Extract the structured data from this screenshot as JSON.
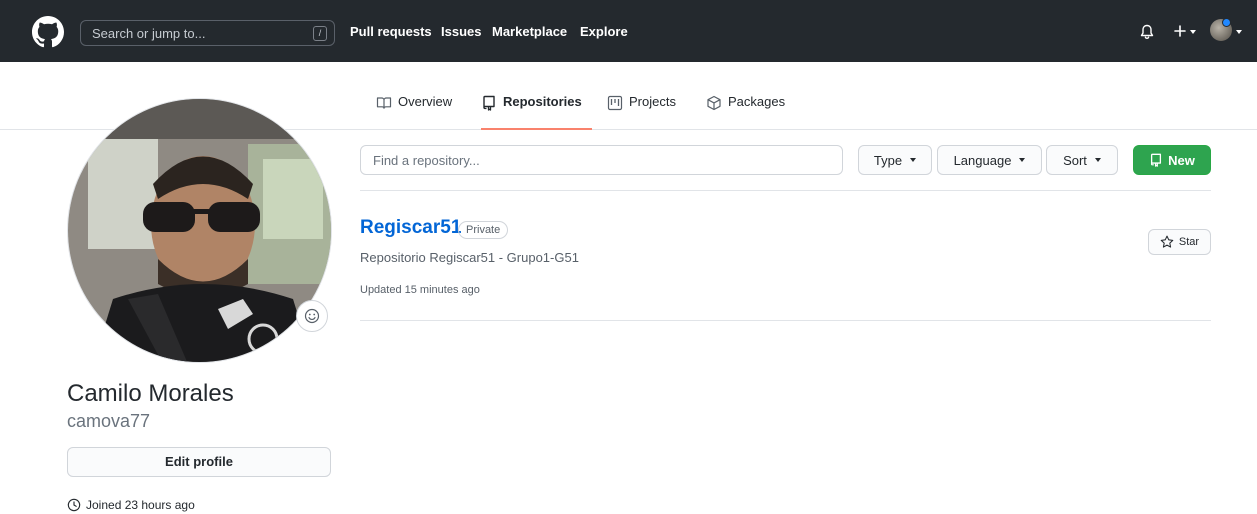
{
  "header": {
    "search_placeholder": "Search or jump to...",
    "search_shortcut": "/",
    "nav": [
      "Pull requests",
      "Issues",
      "Marketplace",
      "Explore"
    ]
  },
  "tabs": [
    {
      "label": "Overview",
      "icon": "book-icon",
      "active": false
    },
    {
      "label": "Repositories",
      "icon": "repo-icon",
      "active": true
    },
    {
      "label": "Projects",
      "icon": "project-icon",
      "active": false
    },
    {
      "label": "Packages",
      "icon": "package-icon",
      "active": false
    }
  ],
  "profile": {
    "full_name": "Camilo Morales",
    "username": "camova77",
    "edit_label": "Edit profile",
    "joined": "Joined 23 hours ago"
  },
  "filters": {
    "search_placeholder": "Find a repository...",
    "type_label": "Type",
    "language_label": "Language",
    "sort_label": "Sort",
    "new_label": "New"
  },
  "repo": {
    "name": "Regiscar51",
    "visibility": "Private",
    "description": "Repositorio Regiscar51 - Grupo1-G51",
    "updated": "Updated 15 minutes ago",
    "star_label": "Star"
  },
  "colors": {
    "header_bg": "#24292e",
    "link": "#0366d6",
    "new_button": "#2ea44f",
    "active_tab_underline": "#f9826c"
  }
}
